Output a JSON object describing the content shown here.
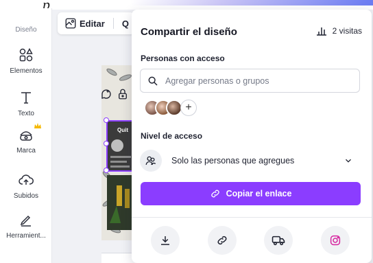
{
  "top_fragment": "p",
  "sidebar": {
    "items": [
      {
        "label": "Diseño",
        "icon": "layout-icon"
      },
      {
        "label": "Elementos",
        "icon": "shapes-icon"
      },
      {
        "label": "Texto",
        "icon": "text-icon"
      },
      {
        "label": "Marca",
        "icon": "brand-icon"
      },
      {
        "label": "Subidos",
        "icon": "cloud-upload-icon"
      },
      {
        "label": "Herramient...",
        "icon": "tools-icon"
      }
    ]
  },
  "toolbar": {
    "edit_label": "Editar",
    "next_label": "Q"
  },
  "canvas": {
    "overlay_text": "Quit"
  },
  "share_panel": {
    "title": "Compartir el diseño",
    "visits": "2 visitas",
    "people_heading": "Personas con acceso",
    "search_placeholder": "Agregar personas o grupos",
    "add_symbol": "+",
    "access_heading": "Nivel de acceso",
    "access_value": "Solo las personas que agregues",
    "copy_button": "Copiar el enlace",
    "actions": [
      {
        "icon": "download-icon"
      },
      {
        "icon": "link-icon"
      },
      {
        "icon": "truck-icon"
      },
      {
        "icon": "instagram-icon"
      }
    ]
  },
  "colors": {
    "accent": "#8b3dff",
    "crown": "#f5b800",
    "instagram": "#d6249f"
  }
}
